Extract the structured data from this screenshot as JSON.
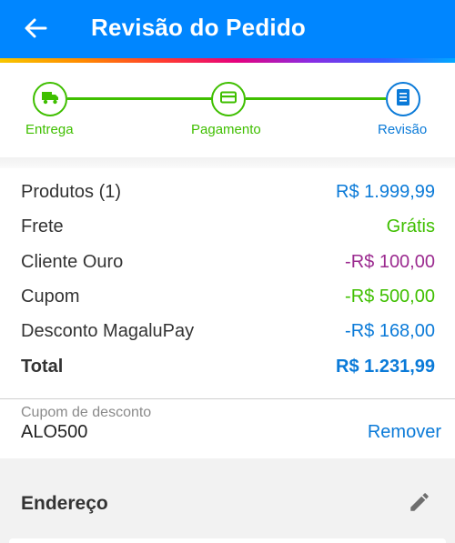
{
  "header": {
    "title": "Revisão do Pedido",
    "back_icon": "arrow-left-icon"
  },
  "colors": {
    "appbar": "#0086ff",
    "step_done": "#3fbf00",
    "step_current": "#0a7ad8",
    "price_blue": "#0a7ad8",
    "green": "#3fbf00",
    "purple": "#9b2a8f"
  },
  "stepper": {
    "steps": [
      {
        "label": "Entrega",
        "icon": "truck-icon",
        "state": "done"
      },
      {
        "label": "Pagamento",
        "icon": "credit-card-icon",
        "state": "done"
      },
      {
        "label": "Revisão",
        "icon": "list-document-icon",
        "state": "current"
      }
    ]
  },
  "summary": {
    "rows": [
      {
        "label": "Produtos (1)",
        "value": "R$ 1.999,99"
      },
      {
        "label": "Frete",
        "value": "Grátis"
      },
      {
        "label": "Cliente Ouro",
        "value": "-R$ 100,00"
      },
      {
        "label": "Cupom",
        "value": "-R$ 500,00"
      },
      {
        "label": "Desconto MagaluPay",
        "value": "-R$ 168,00"
      },
      {
        "label": "Total",
        "value": "R$ 1.231,99"
      }
    ]
  },
  "coupon": {
    "label": "Cupom de desconto",
    "value": "ALO500",
    "remove_label": "Remover"
  },
  "address": {
    "title": "Endereço",
    "edit_icon": "pencil-icon"
  }
}
